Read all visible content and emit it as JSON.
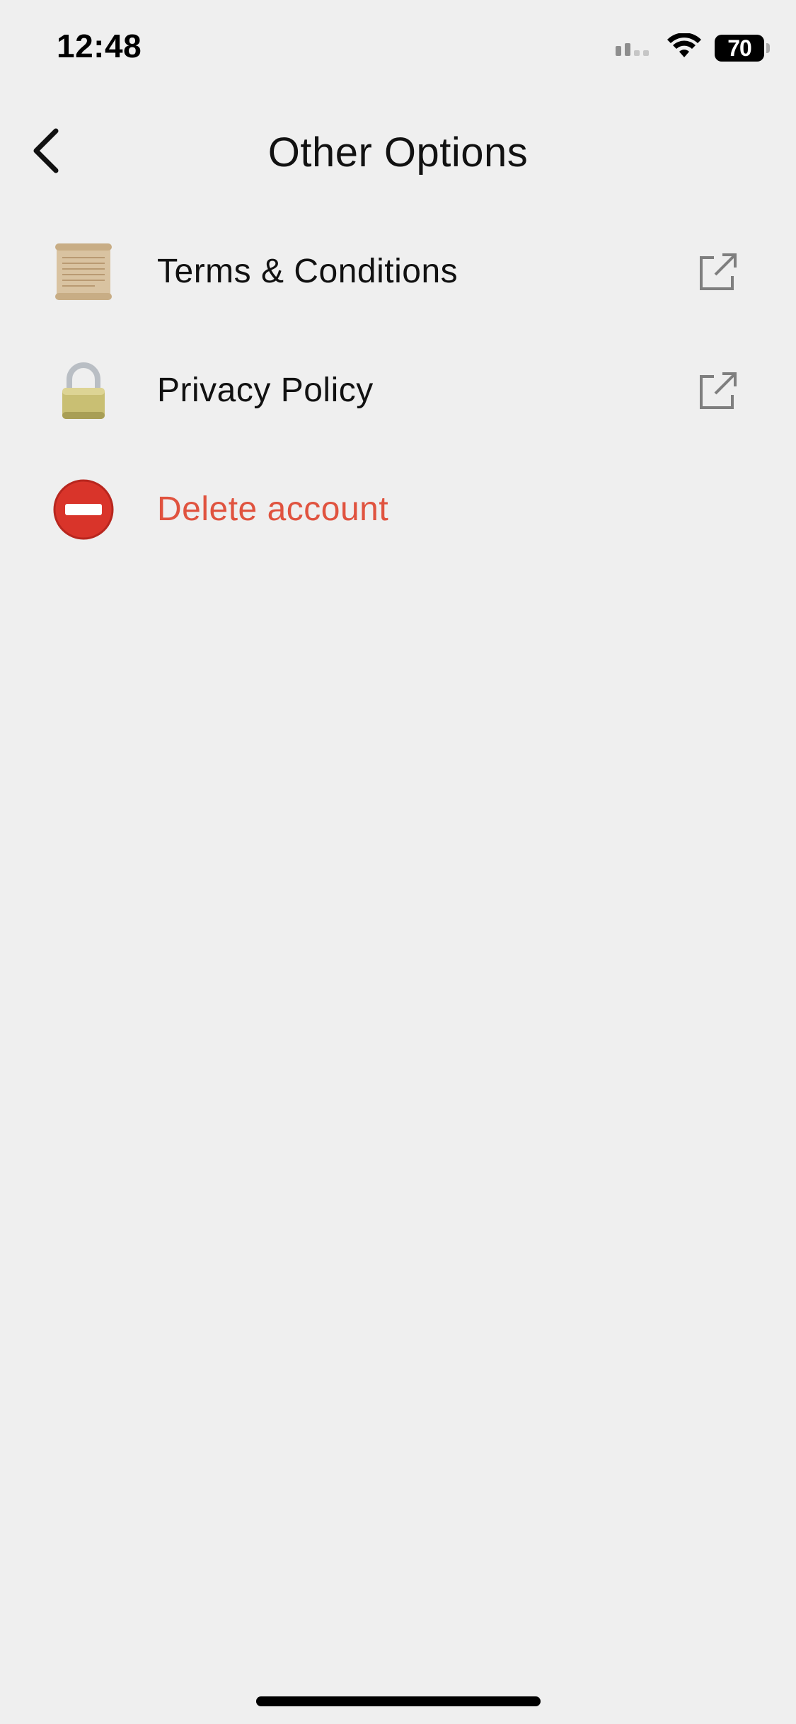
{
  "status_bar": {
    "time": "12:48",
    "battery": "70"
  },
  "header": {
    "title": "Other Options"
  },
  "options": [
    {
      "label": "Terms & Conditions",
      "icon": "scroll-icon",
      "external": true
    },
    {
      "label": "Privacy Policy",
      "icon": "lock-icon",
      "external": true
    },
    {
      "label": "Delete account",
      "icon": "no-entry-icon",
      "external": false
    }
  ],
  "colors": {
    "background": "#efefef",
    "danger": "#e0533f",
    "text": "#111111",
    "external_icon": "#7f7f7f"
  }
}
